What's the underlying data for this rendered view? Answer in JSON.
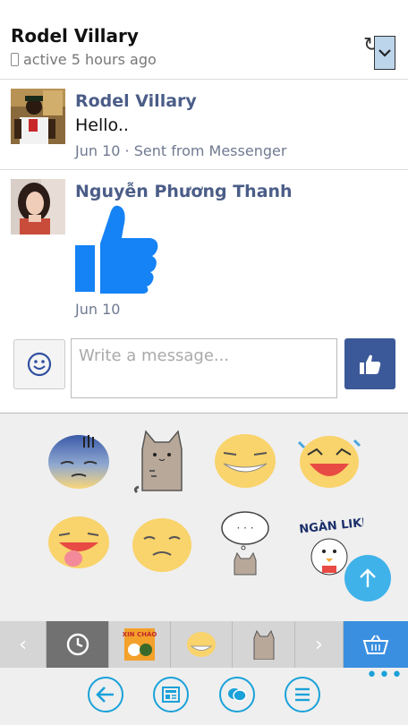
{
  "header": {
    "contact_name": "Rodel Villary",
    "status": "active 5 hours ago"
  },
  "messages": [
    {
      "sender": "Rodel Villary",
      "text": "Hello..",
      "meta": "Jun 10 · Sent from Messenger"
    },
    {
      "sender": "Nguyễn Phương Thanh",
      "sticker": "thumbs-up",
      "meta": "Jun 10"
    }
  ],
  "compose": {
    "placeholder": "Write a message..."
  },
  "sticker_panel": {
    "stickers": [
      "sleepy-face",
      "pusheen-cat",
      "grinning-face",
      "laughing-face",
      "tongue-out-face",
      "worried-face",
      "thinking-cat",
      "ngan-like-sticker"
    ],
    "sticker_word": "NGÀN LIKE",
    "thought_text": "· · ·"
  },
  "sticker_tabs": {
    "items": [
      "prev-arrow",
      "recent-clock",
      "xin-chao-pack",
      "emoji-face-pack",
      "pusheen-pack",
      "next-arrow",
      "store-basket"
    ],
    "xin_chao_label": "XIN CHÀO"
  },
  "bottom_bar": {
    "items": [
      "back-icon",
      "news-feed-icon",
      "chat-icon",
      "menu-icon"
    ],
    "more": "•••"
  },
  "colors": {
    "accent": "#1aa1d9",
    "facebook_blue": "#3b5998",
    "sticker_blue": "#1582f5"
  }
}
